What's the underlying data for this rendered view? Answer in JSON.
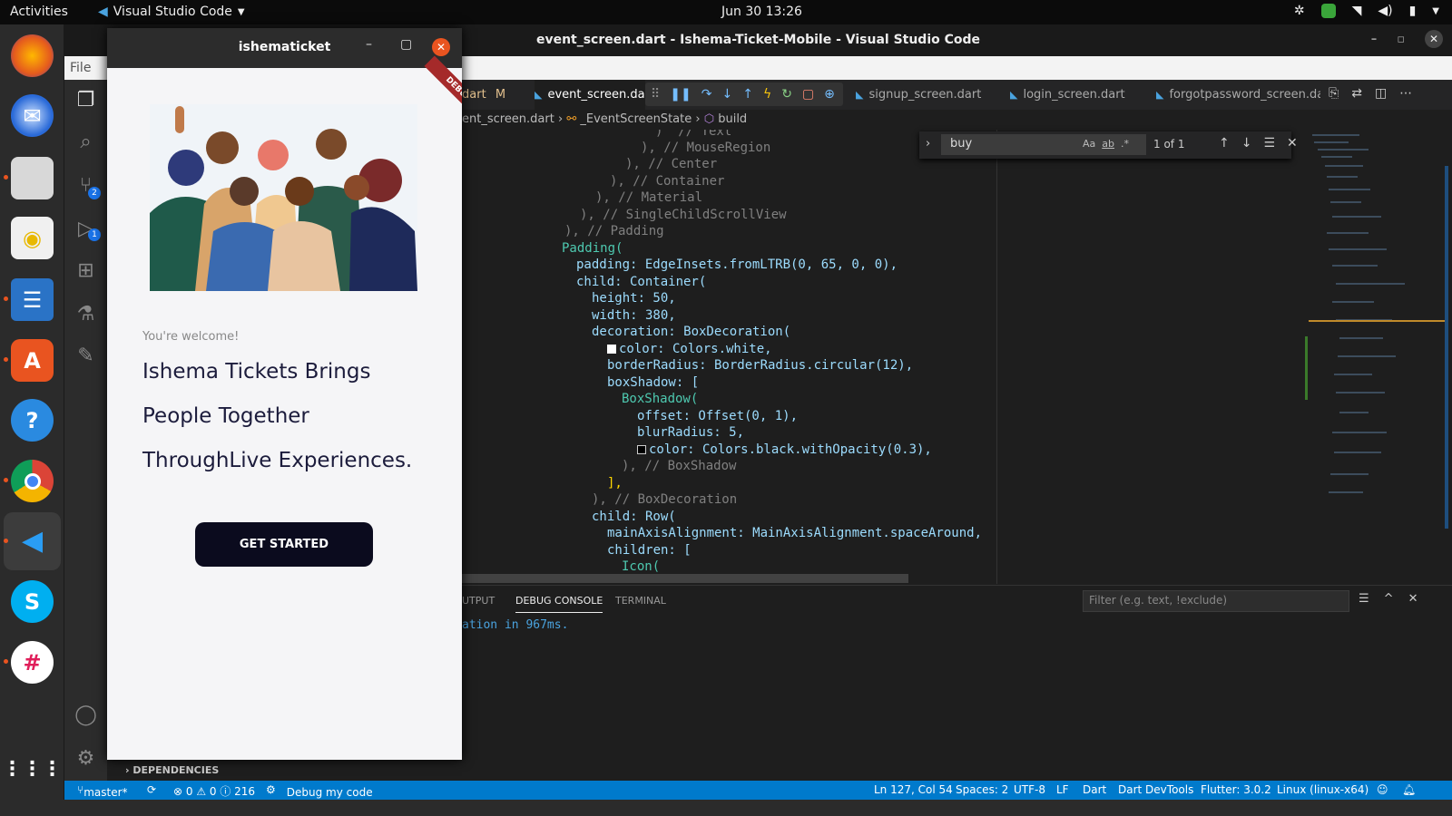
{
  "topbar": {
    "activities": "Activities",
    "app_name": "Visual Studio Code",
    "clock": "Jun 30  13:26"
  },
  "vscode": {
    "window_title": "event_screen.dart - Ishema-Ticket-Mobile - Visual Studio Code",
    "menu_first": "File",
    "tabs": [
      {
        "label": "dart",
        "modified": "M"
      },
      {
        "label": "event_screen.dar"
      },
      {
        "label": "signup_screen.dart"
      },
      {
        "label": "login_screen.dart"
      },
      {
        "label": "forgotpassword_screen.dart"
      }
    ],
    "breadcrumb": {
      "file": "ent_screen.dart",
      "class": "_EventScreenState",
      "method": "build"
    },
    "find": {
      "query": "buy",
      "result": "1 of 1",
      "opt_case": "Aa",
      "opt_word": "ab",
      "opt_regex": ".*"
    },
    "panel": {
      "tab_output": "UTPUT",
      "tab_debug": "DEBUG CONSOLE",
      "tab_terminal": "TERMINAL",
      "filter_placeholder": "Filter (e.g. text, !exclude)",
      "console_line": "ation in 967ms."
    },
    "sidebar_dependencies": "DEPENDENCIES",
    "activity_badges": {
      "scm": "2",
      "debug": "1"
    },
    "status": {
      "branch": "master*",
      "problems": "⊗ 0 ⚠ 0 ⓘ 216",
      "debug": "Debug my code",
      "position": "Ln 127, Col 54",
      "spaces": "Spaces: 2",
      "encoding": "UTF-8",
      "eol": "LF",
      "language": "Dart",
      "devtools": "Dart DevTools",
      "flutter": "Flutter: 3.0.2",
      "device": "Linux (linux-x64)"
    },
    "code": [
      ")  // Text",
      "), // MouseRegion",
      "), // Center",
      "), // Container",
      "), // Material",
      "), // SingleChildScrollView",
      "), // Padding",
      "Padding(",
      "padding: EdgeInsets.fromLTRB(0, 65, 0, 0),",
      "child: Container(",
      "height: 50,",
      "width: 380,",
      "decoration: BoxDecoration(",
      "color: Colors.white,",
      "borderRadius: BorderRadius.circular(12),",
      "boxShadow: [",
      "BoxShadow(",
      "offset: Offset(0, 1),",
      "blurRadius: 5,",
      "color: Colors.black.withOpacity(0.3),",
      "), // BoxShadow",
      "],",
      "), // BoxDecoration",
      "child: Row(",
      "mainAxisAlignment: MainAxisAlignment.spaceAround,",
      "children: [",
      "Icon("
    ]
  },
  "app": {
    "window_title": "ishematicket",
    "debug_ribbon": "DEBUG",
    "welcome": "You're welcome!",
    "headline": [
      "Ishema Tickets Brings",
      "People Together",
      "ThroughLive Experiences."
    ],
    "cta": "GET STARTED"
  }
}
